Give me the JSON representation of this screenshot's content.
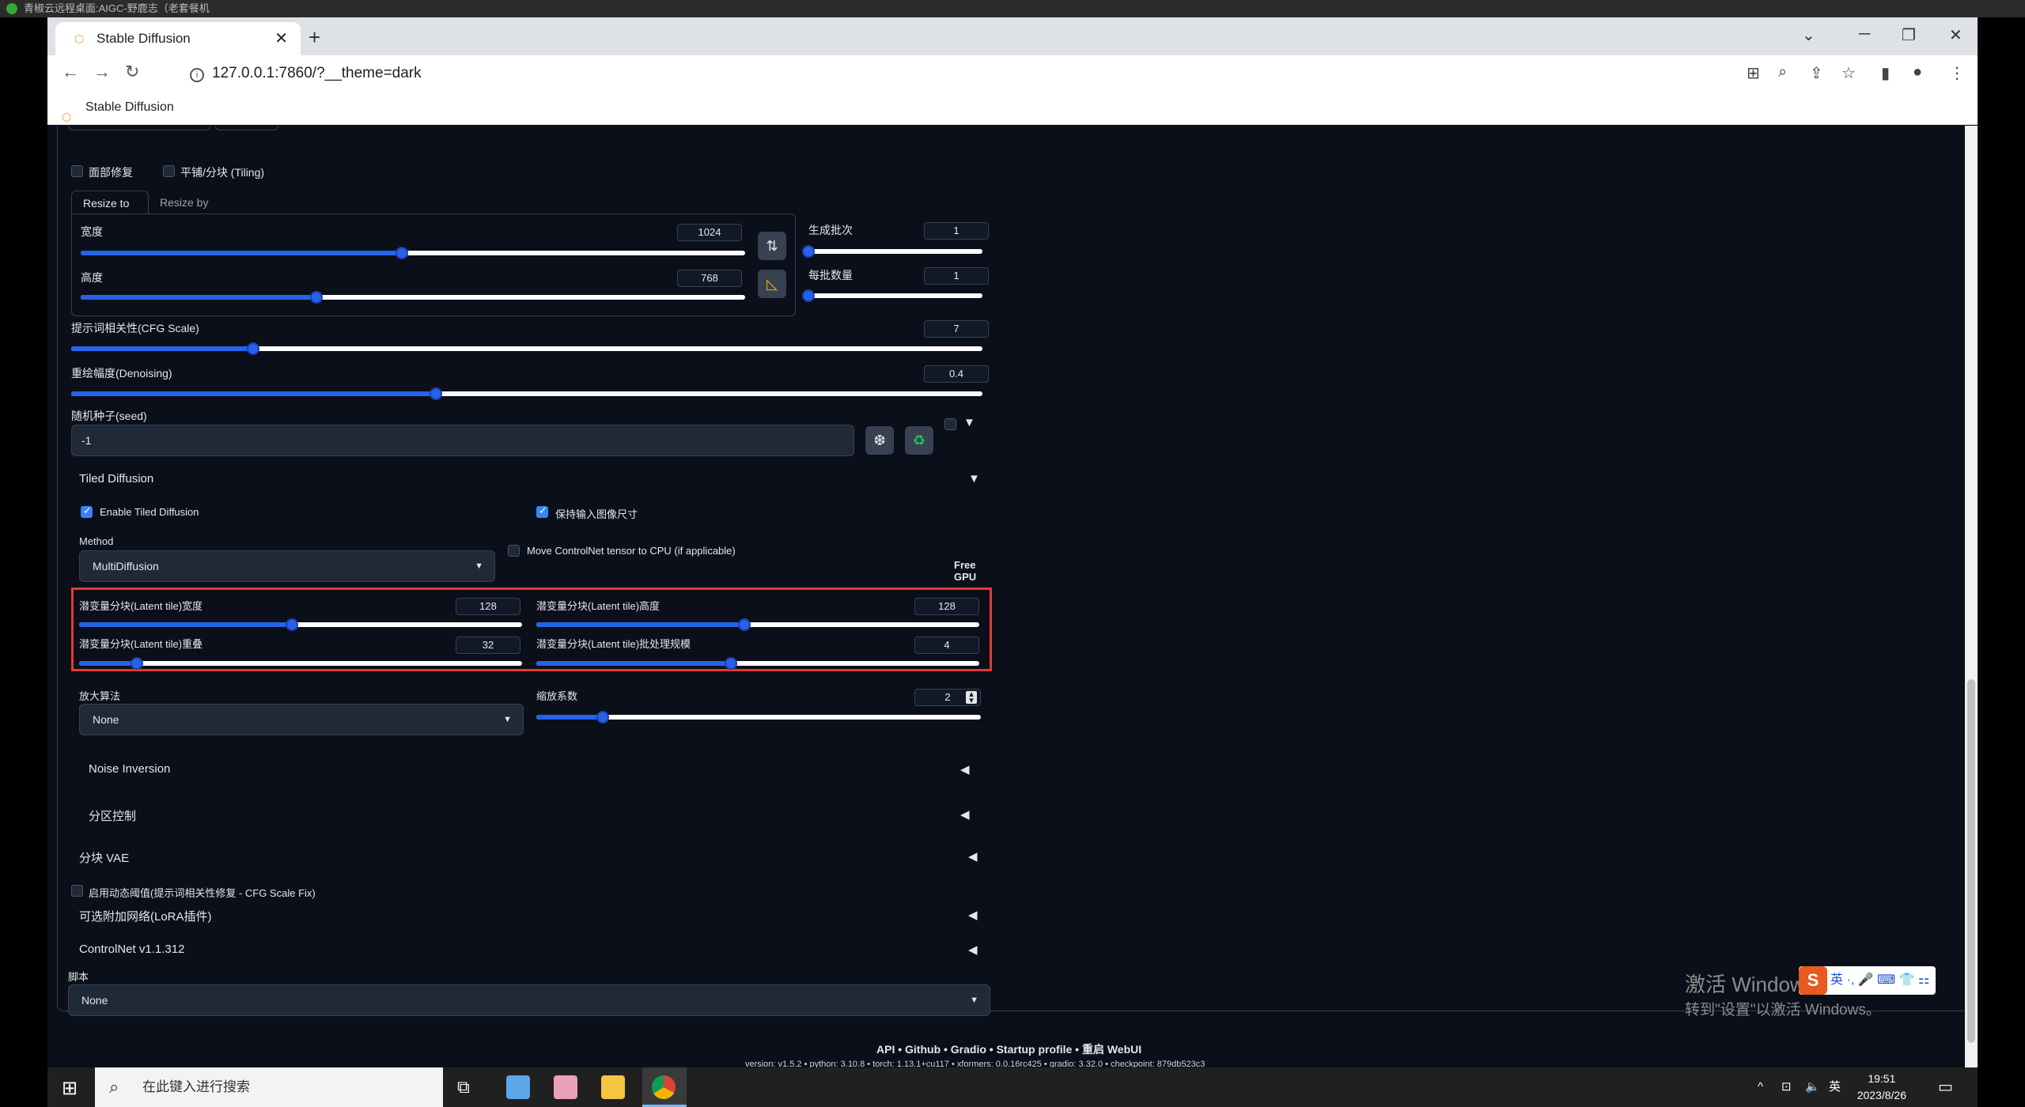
{
  "remote": {
    "title": "青椒云远程桌面:AIGC-野鹿志（老套餐机"
  },
  "browser": {
    "tab_title": "Stable Diffusion",
    "url": "127.0.0.1:7860/?__theme=dark",
    "bookmark": "Stable Diffusion"
  },
  "checks": {
    "face_restore": "面部修复",
    "tiling": "平铺/分块 (Tiling)"
  },
  "resize_tabs": [
    "Resize to",
    "Resize by"
  ],
  "sliders": {
    "width": {
      "label": "宽度",
      "value": "1024",
      "min": 64,
      "max": 2048,
      "num": 1024
    },
    "height": {
      "label": "高度",
      "value": "768",
      "min": 64,
      "max": 2048,
      "num": 768
    },
    "batch_count": {
      "label": "生成批次",
      "value": "1",
      "fraction": 0.0
    },
    "batch_size": {
      "label": "每批数量",
      "value": "1",
      "fraction": 0.0
    },
    "cfg": {
      "label": "提示词相关性(CFG Scale)",
      "value": "7",
      "fraction": 0.2
    },
    "denoise": {
      "label": "重绘幅度(Denoising)",
      "value": "0.4",
      "fraction": 0.4
    }
  },
  "seed": {
    "label": "随机种子(seed)",
    "value": "-1",
    "dice_icon": "dice-icon",
    "recycle_icon": "recycle-icon"
  },
  "tiled": {
    "header": "Tiled Diffusion",
    "enable": "Enable Tiled Diffusion",
    "keep_size": "保持输入图像尺寸",
    "method_label": "Method",
    "method_value": "MultiDiffusion",
    "move_cn": "Move ControlNet tensor to CPU (if applicable)",
    "free_gpu": [
      "Free",
      "GPU"
    ],
    "lt_width": {
      "label": "潜变量分块(Latent tile)宽度",
      "value": "128",
      "fraction": 0.48
    },
    "lt_height": {
      "label": "潜变量分块(Latent tile)高度",
      "value": "128",
      "fraction": 0.47
    },
    "lt_overlap": {
      "label": "潜变量分块(Latent tile)重叠",
      "value": "32",
      "fraction": 0.13
    },
    "lt_batch": {
      "label": "潜变量分块(Latent tile)批处理规模",
      "value": "4",
      "fraction": 0.44
    },
    "upscaler_label": "放大算法",
    "upscaler_value": "None",
    "scale_label": "缩放系数",
    "scale_value": "2",
    "scale_fraction": 0.15,
    "noise_inversion": "Noise Inversion",
    "region_control": "分区控制"
  },
  "tiled_vae": "分块 VAE",
  "cfg_fix": "启用动态阈值(提示词相关性修复 - CFG Scale Fix)",
  "lora": "可选附加网络(LoRA插件)",
  "controlnet": "ControlNet v1.1.312",
  "script_label": "脚本",
  "script_value": "None",
  "footer": {
    "links": "API  •  Github  •  Gradio  •  Startup profile  •  重启 WebUI",
    "version": "version: v1.5.2  •  python: 3.10.8  •  torch: 1.13.1+cu117  •  xformers: 0.0.16rc425  •  gradio: 3.32.0  •  checkpoint: 879db523c3"
  },
  "taskbar": {
    "search_placeholder": "在此键入进行搜索",
    "time": "19:51",
    "date": "2023/8/26",
    "lang": "英"
  },
  "watermark": {
    "line1": "激活 Windows",
    "line2": "转到\"设置\"以激活 Windows。"
  },
  "ime": "英 ·, 🎤 ⌨ 👕 ⚏"
}
